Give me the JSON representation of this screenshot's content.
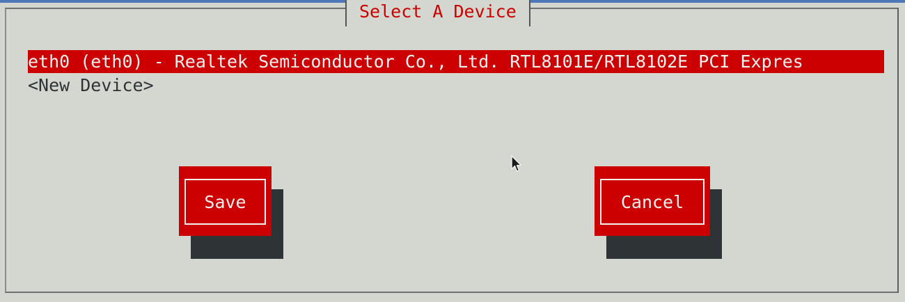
{
  "dialog": {
    "title": "Select A Device"
  },
  "device_list": {
    "items": [
      {
        "label": "eth0 (eth0) - Realtek Semiconductor Co., Ltd. RTL8101E/RTL8102E PCI Expres",
        "selected": true
      },
      {
        "label": "<New Device>",
        "selected": false
      }
    ]
  },
  "buttons": {
    "save_label": "Save",
    "cancel_label": "Cancel"
  },
  "colors": {
    "background": "#d3d7cf",
    "accent": "#cc0000",
    "shadow": "#2e3436",
    "highlight_text": "#f2f2f2"
  },
  "icons": {
    "cursor": "mouse-pointer-icon"
  }
}
